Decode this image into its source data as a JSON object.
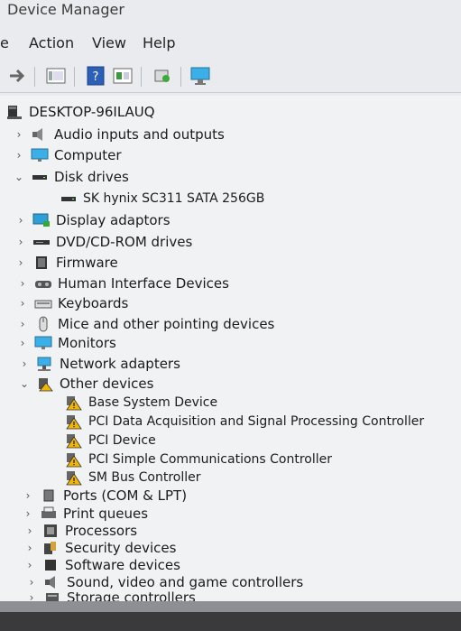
{
  "window": {
    "title": "Device Manager"
  },
  "menu": {
    "file": "e",
    "action": "Action",
    "view": "View",
    "help": "Help"
  },
  "toolbar": {
    "buttons": [
      "back-icon",
      "properties-icon",
      "help-icon",
      "action-icon",
      "scan-icon",
      "monitor-icon"
    ]
  },
  "tree": {
    "root": "DESKTOP-96ILAUQ",
    "categories": [
      {
        "label": "Audio inputs and outputs",
        "expanded": false
      },
      {
        "label": "Computer",
        "expanded": false
      },
      {
        "label": "Disk drives",
        "expanded": true,
        "children": [
          "SK hynix SC311 SATA 256GB"
        ]
      },
      {
        "label": "Display adaptors",
        "expanded": false
      },
      {
        "label": "DVD/CD-ROM drives",
        "expanded": false
      },
      {
        "label": "Firmware",
        "expanded": false
      },
      {
        "label": "Human Interface Devices",
        "expanded": false
      },
      {
        "label": "Keyboards",
        "expanded": false
      },
      {
        "label": "Mice and other pointing devices",
        "expanded": false
      },
      {
        "label": "Monitors",
        "expanded": false
      },
      {
        "label": "Network adapters",
        "expanded": false
      },
      {
        "label": "Other devices",
        "expanded": true,
        "children": [
          "Base System Device",
          "PCI Data Acquisition and Signal Processing Controller",
          "PCI Device",
          "PCI Simple Communications Controller",
          "SM Bus Controller"
        ]
      },
      {
        "label": "Ports (COM & LPT)",
        "expanded": false
      },
      {
        "label": "Print queues",
        "expanded": false
      },
      {
        "label": "Processors",
        "expanded": false
      },
      {
        "label": "Security devices",
        "expanded": false
      },
      {
        "label": "Software devices",
        "expanded": false
      },
      {
        "label": "Sound, video and game controllers",
        "expanded": false
      },
      {
        "label": "Storage controllers",
        "expanded": false
      }
    ]
  },
  "colors": {
    "warning": "#f2b600",
    "accent": "#1e7fd0"
  }
}
